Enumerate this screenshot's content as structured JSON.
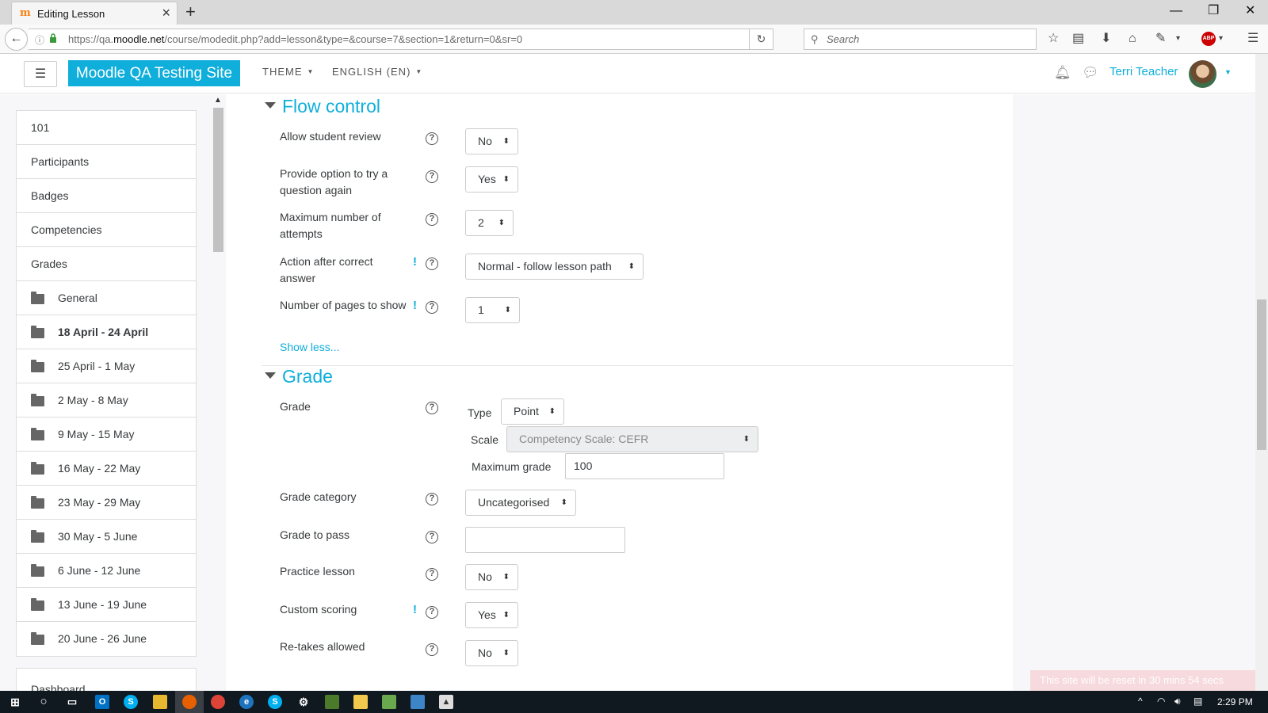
{
  "browser": {
    "tab_title": "Editing Lesson",
    "url_prefix": "https://qa.",
    "url_domain": "moodle.net",
    "url_path": "/course/modedit.php?add=lesson&type=&course=7&section=1&return=0&sr=0",
    "search_placeholder": "Search",
    "abp_label": "ABP"
  },
  "header": {
    "site_name": "Moodle QA Testing Site",
    "theme_menu": "THEME",
    "language_menu": "ENGLISH (EN)",
    "user_name": "Terri Teacher"
  },
  "nav": {
    "items": [
      {
        "label": "101",
        "folder": false,
        "bold": false
      },
      {
        "label": "Participants",
        "folder": false,
        "bold": false
      },
      {
        "label": "Badges",
        "folder": false,
        "bold": false
      },
      {
        "label": "Competencies",
        "folder": false,
        "bold": false
      },
      {
        "label": "Grades",
        "folder": false,
        "bold": false
      },
      {
        "label": "General",
        "folder": true,
        "bold": false
      },
      {
        "label": "18 April - 24 April",
        "folder": true,
        "bold": true
      },
      {
        "label": "25 April - 1 May",
        "folder": true,
        "bold": false
      },
      {
        "label": "2 May - 8 May",
        "folder": true,
        "bold": false
      },
      {
        "label": "9 May - 15 May",
        "folder": true,
        "bold": false
      },
      {
        "label": "16 May - 22 May",
        "folder": true,
        "bold": false
      },
      {
        "label": "23 May - 29 May",
        "folder": true,
        "bold": false
      },
      {
        "label": "30 May - 5 June",
        "folder": true,
        "bold": false
      },
      {
        "label": "6 June - 12 June",
        "folder": true,
        "bold": false
      },
      {
        "label": "13 June - 19 June",
        "folder": true,
        "bold": false
      },
      {
        "label": "20 June - 26 June",
        "folder": true,
        "bold": false
      }
    ],
    "dashboard": "Dashboard"
  },
  "flow_control": {
    "heading": "Flow control",
    "allow_review_label": "Allow student review",
    "allow_review_value": "No",
    "try_again_label": "Provide option to try a question again",
    "try_again_value": "Yes",
    "max_attempts_label": "Maximum number of attempts",
    "max_attempts_value": "2",
    "action_label": "Action after correct answer",
    "action_value": "Normal - follow lesson path",
    "pages_label": "Number of pages to show",
    "pages_value": "1",
    "show_less": "Show less..."
  },
  "grade": {
    "heading": "Grade",
    "grade_label": "Grade",
    "type_label": "Type",
    "type_value": "Point",
    "scale_label": "Scale",
    "scale_value": "Competency Scale: CEFR",
    "max_grade_label": "Maximum grade",
    "max_grade_value": "100",
    "category_label": "Grade category",
    "category_value": "Uncategorised",
    "to_pass_label": "Grade to pass",
    "to_pass_value": "",
    "practice_label": "Practice lesson",
    "practice_value": "No",
    "custom_label": "Custom scoring",
    "custom_value": "Yes",
    "retakes_label": "Re-takes allowed",
    "retakes_value": "No"
  },
  "reset_notice": "This site will be reset in 30 mins 54 secs",
  "taskbar": {
    "clock": "2:29 PM"
  }
}
